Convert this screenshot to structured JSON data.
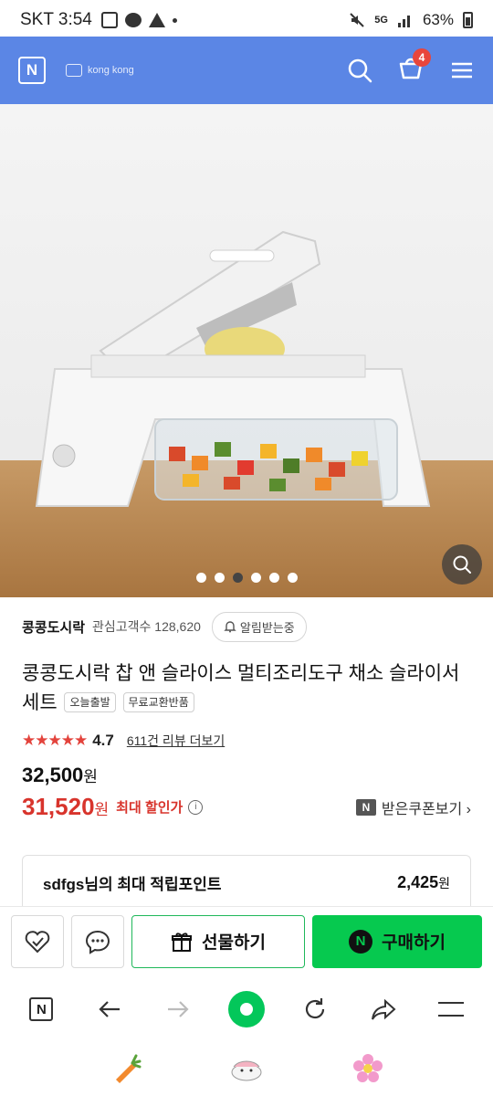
{
  "status_bar": {
    "time": "SKT 3:54",
    "network": "5G",
    "battery": "63%"
  },
  "header": {
    "logo_label": "N",
    "brand": "kong kong",
    "cart_count": "4"
  },
  "gallery": {
    "dot_count": 6,
    "active_dot": 3
  },
  "store": {
    "name": "콩콩도시락",
    "followers_label": "관심고객수 128,620",
    "notify_label": "알림받는중"
  },
  "product": {
    "title": "콩콩도시락 찹 앤 슬라이스 멀티조리도구 채소 슬라이서 세트",
    "tags": [
      "오늘출발",
      "무료교환반품"
    ],
    "stars": "★★★★★",
    "rating": "4.7",
    "review_link": "611건 리뷰 더보기",
    "price_original": "32,500",
    "price_sale": "31,520",
    "currency": "원",
    "max_discount_label": "최대 할인가",
    "coupon_badge": "N",
    "coupon_label": "받은쿠폰보기 ›"
  },
  "points": {
    "label": "sdfgs님의 최대 적립포인트",
    "value": "2,425",
    "currency": "원"
  },
  "purchase_bar": {
    "gift_label": "선물하기",
    "buy_label": "구매하기",
    "buy_badge": "N"
  },
  "browser_nav": {
    "home_label": "N"
  },
  "colors": {
    "header_bg": "#5b86e5",
    "buy_green": "#06c94f",
    "sale_red": "#d8342c",
    "badge_red": "#e8453c"
  }
}
